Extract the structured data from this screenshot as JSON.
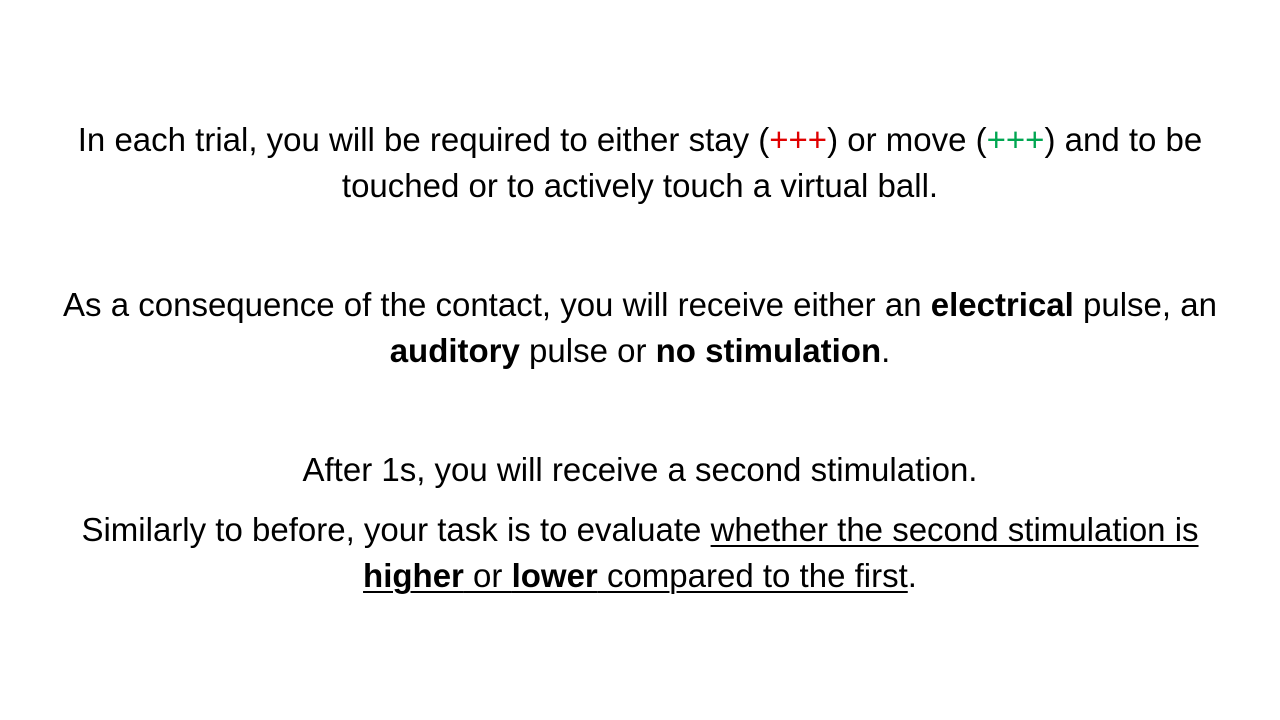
{
  "colors": {
    "stay_marker": "#e00000",
    "move_marker": "#00a651",
    "text": "#000000",
    "background": "#ffffff"
  },
  "para1": {
    "t1": "In each trial, you will be required to either stay (",
    "stay_marker": "+++",
    "t2": ") or move (",
    "move_marker": "+++",
    "t3": ") and to be touched or to actively touch a virtual ball."
  },
  "para2": {
    "t1": "As a consequence of the contact, you will receive either an ",
    "b1": "electrical",
    "t2": " pulse, an ",
    "b2": "auditory",
    "t3": " pulse or ",
    "b3": "no stimulation",
    "t4": "."
  },
  "para3": {
    "text": "After 1s, you will receive a second stimulation."
  },
  "para4": {
    "t1": "Similarly to before, your task is to evaluate ",
    "u1": "whether the second stimulation is ",
    "b1": "higher",
    "u2": " or ",
    "b2": "lower",
    "u3": " compared to the first",
    "t2": "."
  }
}
